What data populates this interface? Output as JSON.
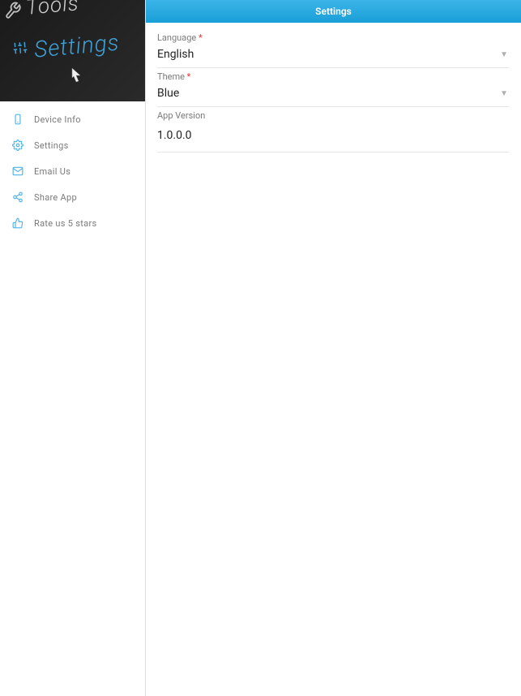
{
  "sidebar": {
    "header": {
      "tools_text": "Tools",
      "settings_text": "Settings"
    },
    "items": [
      {
        "icon": "device-icon",
        "label": "Device Info"
      },
      {
        "icon": "settings-icon",
        "label": "Settings"
      },
      {
        "icon": "email-icon",
        "label": "Email Us"
      },
      {
        "icon": "share-icon",
        "label": "Share App"
      },
      {
        "icon": "rate-icon",
        "label": "Rate us 5 stars"
      }
    ]
  },
  "header": {
    "title": "Settings"
  },
  "fields": {
    "language": {
      "label": "Language",
      "required": "*",
      "value": "English"
    },
    "theme": {
      "label": "Theme",
      "required": "*",
      "value": "Blue"
    },
    "appversion": {
      "label": "App Version",
      "value": "1.0.0.0"
    }
  }
}
